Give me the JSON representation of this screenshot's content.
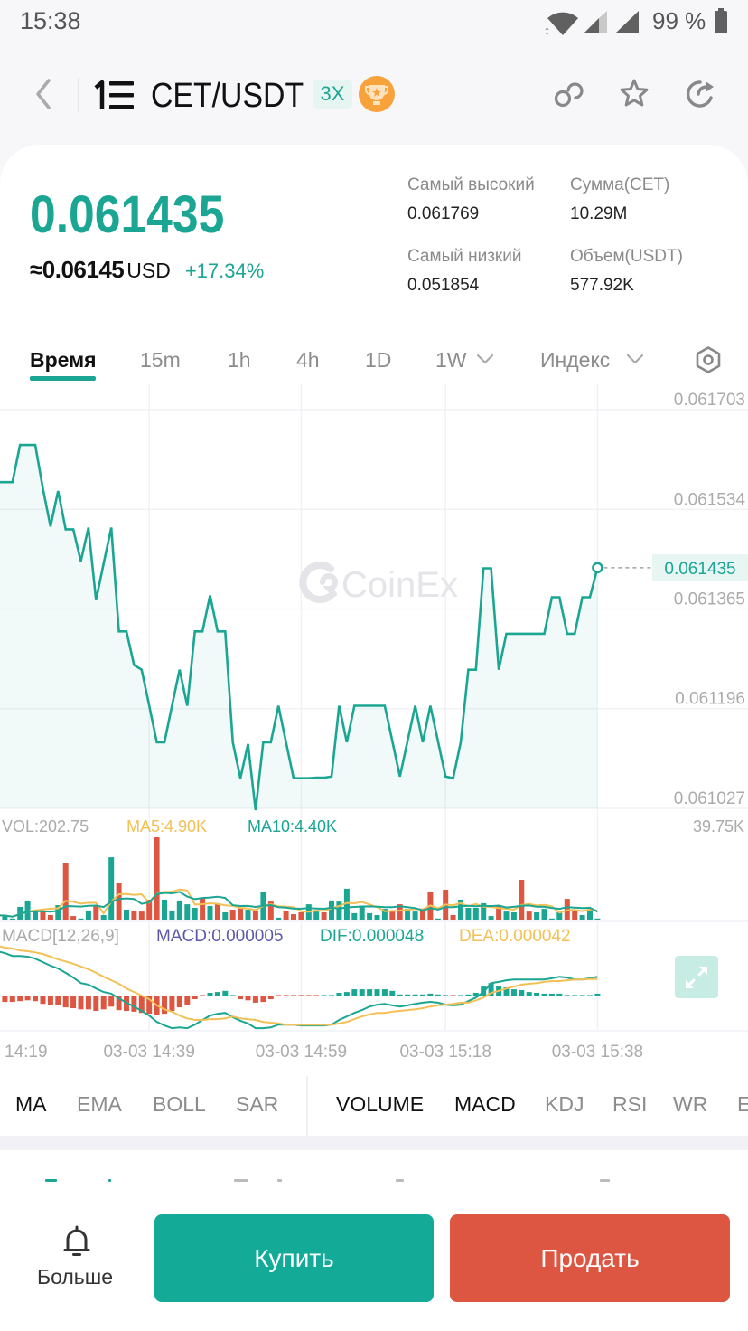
{
  "status_bar": {
    "time": "15:38",
    "battery_text": "99 %",
    "icons": [
      "wifi-icon",
      "signal-icon",
      "signal-icon",
      "battery-icon"
    ]
  },
  "header": {
    "pair": "CET/USDT",
    "leverage_badge": "3X",
    "icons": [
      "back-icon",
      "cet-logo-icon",
      "trophy-icon",
      "link-icon",
      "star-icon",
      "share-icon"
    ]
  },
  "ticker": {
    "last_price": "0.061435",
    "usd_approx": "≈0.06145",
    "usd_unit": "USD",
    "change_24h": "+17.34%",
    "stats": [
      {
        "label": "Самый высокий",
        "value": "0.061769"
      },
      {
        "label": "Сумма(CET)",
        "value": "10.29M"
      },
      {
        "label": "Самый низкий",
        "value": "0.051854"
      },
      {
        "label": "Объем(USDT)",
        "value": "577.92K"
      }
    ]
  },
  "timeframes": [
    {
      "label": "Время",
      "active": true
    },
    {
      "label": "15m",
      "active": false
    },
    {
      "label": "1h",
      "active": false
    },
    {
      "label": "4h",
      "active": false
    },
    {
      "label": "1D",
      "active": false
    },
    {
      "label": "1W",
      "active": false,
      "dropdown": true
    },
    {
      "label": "Индекс",
      "active": false,
      "dropdown": true
    }
  ],
  "watermark": "CoinEx",
  "indicators": {
    "main": [
      {
        "label": "MA",
        "active": true
      },
      {
        "label": "EMA",
        "active": false
      },
      {
        "label": "BOLL",
        "active": false
      },
      {
        "label": "SAR",
        "active": false
      }
    ],
    "sub": [
      {
        "label": "VOLUME",
        "active": true
      },
      {
        "label": "MACD",
        "active": true
      },
      {
        "label": "KDJ",
        "active": false
      },
      {
        "label": "RSI",
        "active": false
      },
      {
        "label": "WR",
        "active": false
      },
      {
        "label": "E",
        "active": false
      }
    ]
  },
  "actions": {
    "more": "Больше",
    "buy": "Купить",
    "sell": "Продать"
  },
  "colors": {
    "up": "#1aa692",
    "down": "#dc5642",
    "ma5": "#f2c054",
    "ma10": "#1aa692",
    "macd": "#5c57a6",
    "buy": "#13ab97",
    "sell": "#dc5642"
  },
  "chart_data": [
    {
      "type": "area",
      "name": "price",
      "title": "CET/USDT",
      "interval": "1m",
      "x_ticks": [
        {
          "index": 0,
          "label": "14:19"
        },
        {
          "index": 20,
          "label": "03-03 14:39"
        },
        {
          "index": 40,
          "label": "03-03 14:59"
        },
        {
          "index": 59,
          "label": "03-03 15:18"
        },
        {
          "index": 79,
          "label": "03-03 15:38"
        }
      ],
      "values": [
        0.06158,
        0.06158,
        0.06158,
        0.061643,
        0.061643,
        0.061643,
        0.061569,
        0.061505,
        0.061565,
        0.0615,
        0.0615,
        0.061446,
        0.061503,
        0.06138,
        0.061442,
        0.061503,
        0.061327,
        0.061327,
        0.06127,
        0.061262,
        0.061201,
        0.061139,
        0.061139,
        0.061201,
        0.061262,
        0.061201,
        0.061327,
        0.061327,
        0.061388,
        0.061327,
        0.061327,
        0.061139,
        0.061078,
        0.061136,
        0.061024,
        0.061139,
        0.061139,
        0.061201,
        0.061139,
        0.061078,
        0.061078,
        0.061078,
        0.061079,
        0.061079,
        0.061081,
        0.061201,
        0.061139,
        0.061201,
        0.061201,
        0.061201,
        0.061201,
        0.061201,
        0.061141,
        0.061081,
        0.061141,
        0.061201,
        0.061139,
        0.061201,
        0.061141,
        0.061081,
        0.061078,
        0.061139,
        0.061262,
        0.061262,
        0.061434,
        0.061434,
        0.061262,
        0.061323,
        0.061323,
        0.061323,
        0.061323,
        0.061323,
        0.061323,
        0.061385,
        0.061385,
        0.061323,
        0.061323,
        0.061385,
        0.061385,
        0.061435
      ],
      "ylim": [
        0.061027,
        0.061703
      ],
      "y_ticks": [
        0.061703,
        0.061534,
        0.061365,
        0.061196,
        0.061027
      ],
      "last_value": 0.061435,
      "last_label": "0.061435",
      "grid": true,
      "y_axis_position": "right"
    },
    {
      "type": "bar",
      "name": "volume",
      "unit": "K",
      "values": [
        2.0,
        1.9,
        0.4,
        6.1,
        9.2,
        4.4,
        4.4,
        2.2,
        7.0,
        27.5,
        1.7,
        0.1,
        4.4,
        6.6,
        2.2,
        30.1,
        17.9,
        4.8,
        4.4,
        3.9,
        9.6,
        39.75,
        9.6,
        4.4,
        9.2,
        7.4,
        5.7,
        10.5,
        6.6,
        7.9,
        3.5,
        4.8,
        5.7,
        4.8,
        4.4,
        13.1,
        8.7,
        0.9,
        4.4,
        2.6,
        3.5,
        7.4,
        3.9,
        3.5,
        9.2,
        8.7,
        14.9,
        3.1,
        6.6,
        3.1,
        2.2,
        5.2,
        3.9,
        7.4,
        5.2,
        3.9,
        4.4,
        13.1,
        0.4,
        14.4,
        2.2,
        9.6,
        5.7,
        5.7,
        7.9,
        1.7,
        7.0,
        3.9,
        3.5,
        19.2,
        3.9,
        3.5,
        5.2,
        0.4,
        3.5,
        10.0,
        4.4,
        2.2,
        4.8,
        0.20275
      ],
      "side": [
        1,
        1,
        1,
        1,
        1,
        1,
        -1,
        -1,
        1,
        -1,
        -1,
        1,
        1,
        -1,
        1,
        1,
        -1,
        1,
        -1,
        -1,
        -1,
        -1,
        1,
        1,
        1,
        1,
        1,
        -1,
        1,
        -1,
        1,
        -1,
        -1,
        1,
        -1,
        1,
        -1,
        1,
        -1,
        -1,
        -1,
        1,
        1,
        -1,
        1,
        1,
        1,
        1,
        1,
        1,
        1,
        1,
        -1,
        -1,
        1,
        1,
        -1,
        -1,
        1,
        -1,
        -1,
        1,
        1,
        1,
        1,
        1,
        -1,
        1,
        1,
        -1,
        -1,
        1,
        1,
        1,
        1,
        -1,
        -1,
        1,
        1,
        1
      ],
      "ylim": [
        0,
        39.75
      ],
      "y_max_label": "39.75K",
      "ma_periods": [
        5,
        10
      ],
      "legend": {
        "vol": "VOL:202.75",
        "ma5": "MA5:4.90K",
        "ma10": "MA10:4.40K"
      }
    },
    {
      "type": "bar",
      "name": "macd",
      "params": [
        12,
        26,
        9
      ],
      "value_scale": "1e-6",
      "hist": [
        -16,
        -16,
        -16,
        -14,
        -12,
        -14,
        -21,
        -25,
        -25,
        -30,
        -32,
        -35,
        -35,
        -39,
        -35,
        -28,
        -37,
        -39,
        -41,
        -44,
        -46,
        -48,
        -46,
        -39,
        -30,
        -23,
        -9,
        -1,
        7,
        9,
        12,
        1,
        -9,
        -12,
        -18,
        -16,
        -9,
        -2,
        -2,
        -2,
        -2,
        -1,
        -1,
        1,
        2,
        7,
        9,
        16,
        16,
        16,
        16,
        16,
        12,
        3,
        3,
        3,
        3,
        5,
        3,
        1,
        -1,
        1,
        3,
        7,
        23,
        32,
        25,
        21,
        16,
        14,
        9,
        7,
        5,
        5,
        5,
        2,
        1,
        1,
        1,
        5
      ],
      "dif": [
        113,
        108,
        101,
        101,
        99,
        94,
        85,
        76,
        69,
        58,
        46,
        32,
        28,
        18,
        9,
        5,
        -7,
        -18,
        -28,
        -39,
        -51,
        -67,
        -76,
        -83,
        -81,
        -83,
        -74,
        -62,
        -51,
        -46,
        -44,
        -55,
        -64,
        -71,
        -83,
        -83,
        -81,
        -74,
        -74,
        -74,
        -76,
        -76,
        -76,
        -76,
        -74,
        -62,
        -53,
        -44,
        -37,
        -28,
        -23,
        -21,
        -25,
        -28,
        -25,
        -21,
        -18,
        -16,
        -18,
        -23,
        -25,
        -23,
        -14,
        -5,
        9,
        32,
        35,
        39,
        41,
        41,
        41,
        41,
        41,
        44,
        48,
        46,
        41,
        41,
        44,
        48
      ],
      "dea": [
        127,
        122,
        120,
        115,
        113,
        110,
        106,
        99,
        92,
        87,
        81,
        74,
        67,
        58,
        48,
        39,
        30,
        18,
        9,
        0,
        -9,
        -25,
        -35,
        -41,
        -51,
        -58,
        -62,
        -62,
        -60,
        -60,
        -58,
        -53,
        -58,
        -60,
        -62,
        -67,
        -69,
        -71,
        -74,
        -74,
        -74,
        -74,
        -74,
        -74,
        -74,
        -71,
        -67,
        -60,
        -53,
        -48,
        -44,
        -44,
        -41,
        -39,
        -37,
        -35,
        -32,
        -28,
        -25,
        -23,
        -21,
        -18,
        -18,
        -12,
        -5,
        7,
        12,
        18,
        23,
        28,
        30,
        32,
        35,
        37,
        37,
        39,
        41,
        41,
        42,
        42
      ],
      "ylim": [
        -85,
        129
      ],
      "legend": {
        "name": "MACD[12,26,9]",
        "macd": "MACD:0.000005",
        "dif": "DIF:0.000048",
        "dea": "DEA:0.000042"
      }
    }
  ]
}
